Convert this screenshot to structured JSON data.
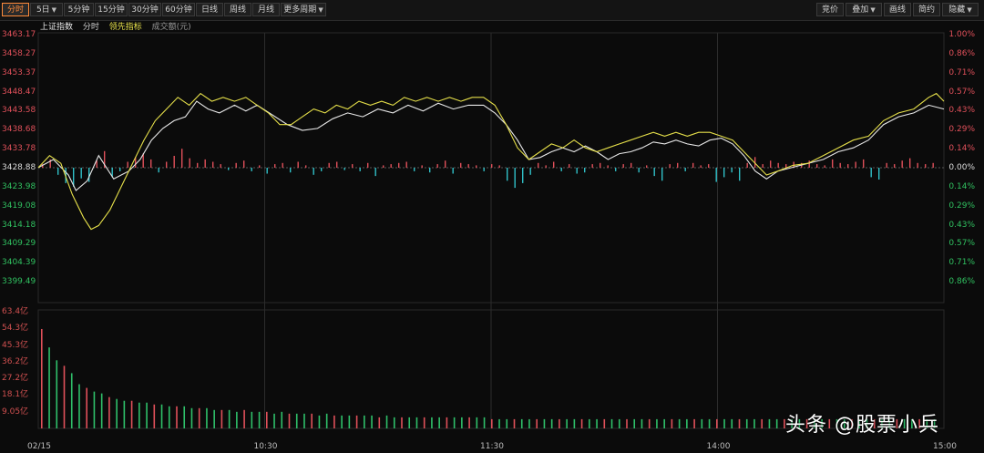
{
  "toolbar": {
    "left": [
      {
        "label": "分时",
        "active": true
      },
      {
        "label": "5日",
        "dropdown": true
      },
      {
        "label": "5分钟"
      },
      {
        "label": "15分钟"
      },
      {
        "label": "30分钟"
      },
      {
        "label": "60分钟"
      },
      {
        "label": "日线"
      },
      {
        "label": "周线"
      },
      {
        "label": "月线"
      },
      {
        "label": "更多周期",
        "dropdown": true
      }
    ],
    "right": [
      {
        "label": "竞价"
      },
      {
        "label": "叠加",
        "dropdown": true
      },
      {
        "label": "画线"
      },
      {
        "label": "简约"
      },
      {
        "label": "隐藏",
        "dropdown": true
      }
    ]
  },
  "legend": {
    "index": "上证指数",
    "time": "分时",
    "leading": "领先指标",
    "volume": "成交额(元)"
  },
  "watermark": "头条 @股票小兵",
  "chart_data": {
    "type": "line",
    "y_left_ticks": [
      "3463.17",
      "3458.27",
      "3453.37",
      "3448.47",
      "3443.58",
      "3438.68",
      "3433.78",
      "3428.88",
      "3423.98",
      "3419.08",
      "3414.18",
      "3409.29",
      "3404.39",
      "3399.49"
    ],
    "y_right_ticks": [
      "1.00%",
      "0.86%",
      "0.71%",
      "0.57%",
      "0.43%",
      "0.29%",
      "0.14%",
      "0.00%",
      "0.14%",
      "0.29%",
      "0.43%",
      "0.57%",
      "0.71%",
      "0.86%"
    ],
    "prev_close": 3428.88,
    "y_range": [
      3394.59,
      3463.17
    ],
    "volume_ticks": [
      "63.4亿",
      "54.3亿",
      "45.3亿",
      "36.2亿",
      "27.2亿",
      "18.1亿",
      "9.05亿"
    ],
    "volume_range": [
      0,
      63.4
    ],
    "x_ticks": [
      "02/15",
      "10:30",
      "11:30",
      "14:00",
      "15:00"
    ],
    "session_minutes": 240,
    "x_tick_minutes": [
      0,
      60,
      120,
      180,
      240
    ],
    "colors": {
      "index": "#e8e8e8",
      "leading": "#e6e04a",
      "up": "#e0505a",
      "down": "#30c0c8",
      "vol_up": "#e0505a",
      "vol_down": "#2fc06a",
      "axis_up": "#e0505a",
      "axis_down": "#30c060"
    },
    "series": [
      {
        "name": "上证指数",
        "points": [
          [
            0,
            3428.9
          ],
          [
            4,
            3431
          ],
          [
            8,
            3427
          ],
          [
            10,
            3423
          ],
          [
            13,
            3425.5
          ],
          [
            16,
            3432
          ],
          [
            20,
            3426
          ],
          [
            24,
            3428
          ],
          [
            27,
            3431
          ],
          [
            30,
            3436
          ],
          [
            33,
            3439
          ],
          [
            36,
            3441
          ],
          [
            39,
            3442
          ],
          [
            42,
            3446
          ],
          [
            45,
            3444
          ],
          [
            48,
            3443
          ],
          [
            52,
            3445
          ],
          [
            55,
            3443.5
          ],
          [
            58,
            3445
          ],
          [
            62,
            3442.5
          ],
          [
            66,
            3440
          ],
          [
            70,
            3438.5
          ],
          [
            74,
            3439
          ],
          [
            78,
            3441.5
          ],
          [
            82,
            3443
          ],
          [
            86,
            3442
          ],
          [
            90,
            3444
          ],
          [
            94,
            3443
          ],
          [
            98,
            3445
          ],
          [
            102,
            3443.5
          ],
          [
            106,
            3445.5
          ],
          [
            110,
            3444
          ],
          [
            114,
            3445
          ],
          [
            118,
            3445
          ],
          [
            121,
            3443
          ],
          [
            124,
            3440
          ],
          [
            127,
            3436
          ],
          [
            130,
            3431
          ],
          [
            133,
            3431.5
          ],
          [
            136,
            3433
          ],
          [
            139,
            3434
          ],
          [
            142,
            3433
          ],
          [
            145,
            3434.5
          ],
          [
            148,
            3433
          ],
          [
            151,
            3431
          ],
          [
            154,
            3432.5
          ],
          [
            157,
            3433
          ],
          [
            160,
            3434
          ],
          [
            163,
            3435.5
          ],
          [
            166,
            3435
          ],
          [
            169,
            3436
          ],
          [
            172,
            3435
          ],
          [
            175,
            3434.5
          ],
          [
            178,
            3436
          ],
          [
            181,
            3436.5
          ],
          [
            184,
            3435
          ],
          [
            187,
            3432
          ],
          [
            190,
            3428
          ],
          [
            193,
            3426
          ],
          [
            196,
            3428
          ],
          [
            200,
            3429
          ],
          [
            204,
            3430
          ],
          [
            208,
            3431
          ],
          [
            212,
            3433
          ],
          [
            216,
            3434
          ],
          [
            220,
            3436
          ],
          [
            224,
            3440
          ],
          [
            228,
            3442
          ],
          [
            232,
            3443
          ],
          [
            236,
            3445
          ],
          [
            240,
            3444
          ]
        ]
      },
      {
        "name": "领先指标",
        "points": [
          [
            0,
            3428.9
          ],
          [
            3,
            3432
          ],
          [
            6,
            3430
          ],
          [
            9,
            3422
          ],
          [
            12,
            3416
          ],
          [
            14,
            3413
          ],
          [
            16,
            3414
          ],
          [
            19,
            3418
          ],
          [
            22,
            3424
          ],
          [
            25,
            3430
          ],
          [
            28,
            3436
          ],
          [
            31,
            3441
          ],
          [
            34,
            3444
          ],
          [
            37,
            3447
          ],
          [
            40,
            3445
          ],
          [
            43,
            3448
          ],
          [
            46,
            3446
          ],
          [
            49,
            3447
          ],
          [
            52,
            3446
          ],
          [
            55,
            3447
          ],
          [
            58,
            3445
          ],
          [
            61,
            3443
          ],
          [
            64,
            3440
          ],
          [
            67,
            3440
          ],
          [
            70,
            3442
          ],
          [
            73,
            3444
          ],
          [
            76,
            3443
          ],
          [
            79,
            3445
          ],
          [
            82,
            3444
          ],
          [
            85,
            3446
          ],
          [
            88,
            3445
          ],
          [
            91,
            3446
          ],
          [
            94,
            3445
          ],
          [
            97,
            3447
          ],
          [
            100,
            3446
          ],
          [
            103,
            3447
          ],
          [
            106,
            3446
          ],
          [
            109,
            3447
          ],
          [
            112,
            3446
          ],
          [
            115,
            3447
          ],
          [
            118,
            3447
          ],
          [
            121,
            3445
          ],
          [
            124,
            3440
          ],
          [
            127,
            3434
          ],
          [
            130,
            3431
          ],
          [
            133,
            3433
          ],
          [
            136,
            3435
          ],
          [
            139,
            3434
          ],
          [
            142,
            3436
          ],
          [
            145,
            3434
          ],
          [
            148,
            3433
          ],
          [
            151,
            3434
          ],
          [
            154,
            3435
          ],
          [
            157,
            3436
          ],
          [
            160,
            3437
          ],
          [
            163,
            3438
          ],
          [
            166,
            3437
          ],
          [
            169,
            3438
          ],
          [
            172,
            3437
          ],
          [
            175,
            3438
          ],
          [
            178,
            3438
          ],
          [
            181,
            3437
          ],
          [
            184,
            3436
          ],
          [
            187,
            3433
          ],
          [
            190,
            3430
          ],
          [
            193,
            3427
          ],
          [
            196,
            3428
          ],
          [
            200,
            3429.5
          ],
          [
            204,
            3430
          ],
          [
            208,
            3432
          ],
          [
            212,
            3434
          ],
          [
            216,
            3436
          ],
          [
            220,
            3437
          ],
          [
            224,
            3441
          ],
          [
            228,
            3443
          ],
          [
            232,
            3444
          ],
          [
            236,
            3447
          ],
          [
            238,
            3448
          ],
          [
            240,
            3446
          ]
        ]
      }
    ],
    "bars_updown": [
      0.6,
      1.4,
      -1.2,
      -2.6,
      -3.2,
      -1.8,
      -2.4,
      1.2,
      2.8,
      -1.6,
      -0.6,
      1.0,
      1.8,
      2.4,
      1.4,
      -0.8,
      1.0,
      2.0,
      3.2,
      1.6,
      0.8,
      1.4,
      1.0,
      0.6,
      -0.4,
      0.8,
      1.2,
      -0.6,
      0.4,
      -1.0,
      0.6,
      0.8,
      -0.8,
      1.0,
      0.4,
      -1.2,
      -0.6,
      0.8,
      1.0,
      -0.4,
      0.6,
      -0.6,
      0.8,
      -1.4,
      0.4,
      0.6,
      0.8,
      1.0,
      -0.6,
      0.4,
      -0.8,
      0.6,
      1.2,
      -1.0,
      0.8,
      0.6,
      0.4,
      -0.6,
      0.6,
      0.4,
      -2.2,
      -3.4,
      -2.6,
      -1.2,
      0.8,
      0.4,
      1.0,
      -0.6,
      0.6,
      -1.0,
      -0.8,
      0.6,
      0.8,
      0.4,
      -0.6,
      0.6,
      0.8,
      -0.8,
      0.4,
      -1.4,
      -2.2,
      0.6,
      0.8,
      -0.6,
      0.8,
      0.4,
      0.6,
      -2.4,
      -1.6,
      -0.8,
      -2.2,
      0.8,
      1.8,
      0.6,
      1.2,
      0.8,
      0.6,
      1.0,
      0.8,
      1.2,
      0.6,
      0.4,
      1.4,
      0.8,
      0.6,
      1.0,
      1.4,
      -1.6,
      -2.0,
      0.8,
      0.6,
      1.2,
      1.6,
      0.8,
      0.6,
      0.8
    ],
    "volume": [
      54,
      44,
      37,
      34,
      30,
      24,
      22,
      20,
      19,
      17,
      16,
      15,
      15,
      14,
      14,
      13,
      13,
      12,
      12,
      12,
      11,
      11,
      11,
      10,
      10,
      10,
      9,
      10,
      9,
      9,
      9,
      8,
      9,
      8,
      8,
      8,
      8,
      7,
      8,
      7,
      7,
      7,
      7,
      7,
      7,
      6,
      7,
      6,
      6,
      6,
      6,
      6,
      6,
      6,
      6,
      6,
      6,
      6,
      6,
      6,
      5,
      5,
      5,
      5,
      5,
      5,
      5,
      5,
      5,
      5,
      5,
      5,
      5,
      5,
      5,
      5,
      5,
      5,
      5,
      5,
      5,
      5,
      5,
      5,
      5,
      5,
      5,
      5,
      5,
      5,
      5,
      5,
      5,
      5,
      5,
      5,
      5,
      5,
      5,
      5,
      5,
      5,
      5,
      5,
      5,
      5,
      5,
      5,
      5,
      5,
      5,
      5,
      5,
      5,
      5,
      5,
      5,
      5,
      5,
      5
    ]
  }
}
